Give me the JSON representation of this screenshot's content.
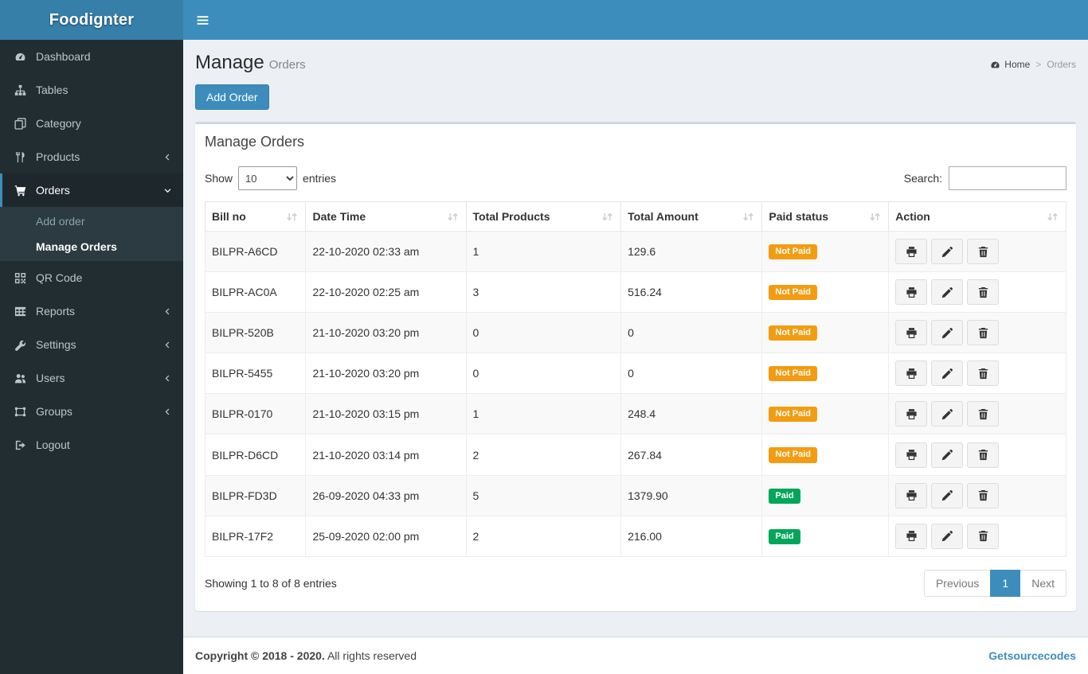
{
  "brand": "Foodignter",
  "colors": {
    "accent": "#3c8dbc",
    "logo_bg": "#367fa9",
    "sidebar_bg": "#222d32",
    "submenu_bg": "#2c3b41",
    "content_bg": "#ecf0f5",
    "not_paid_badge": "#f39c12",
    "paid_badge": "#00a65a"
  },
  "sidebar": {
    "items": [
      {
        "label": "Dashboard",
        "icon": "dashboard"
      },
      {
        "label": "Tables",
        "icon": "sitemap"
      },
      {
        "label": "Category",
        "icon": "copy"
      },
      {
        "label": "Products",
        "icon": "cutlery",
        "chevron": "left"
      },
      {
        "label": "Orders",
        "icon": "cart",
        "chevron": "down",
        "active": true,
        "submenu": [
          {
            "label": "Add order"
          },
          {
            "label": "Manage Orders",
            "active": true
          }
        ]
      },
      {
        "label": "QR Code",
        "icon": "qrcode"
      },
      {
        "label": "Reports",
        "icon": "table",
        "chevron": "left"
      },
      {
        "label": "Settings",
        "icon": "wrench",
        "chevron": "left"
      },
      {
        "label": "Users",
        "icon": "users",
        "chevron": "left"
      },
      {
        "label": "Groups",
        "icon": "group",
        "chevron": "left"
      },
      {
        "label": "Logout",
        "icon": "logout"
      }
    ]
  },
  "content_header": {
    "title": "Manage",
    "subtitle": "Orders",
    "breadcrumb": {
      "home": "Home",
      "separator": ">",
      "current": "Orders"
    }
  },
  "add_order_button": "Add Order",
  "box": {
    "title": "Manage Orders",
    "length_menu": {
      "prefix": "Show",
      "selected": "10",
      "suffix": "entries"
    },
    "search_label": "Search:",
    "table": {
      "columns": [
        "Bill no",
        "Date Time",
        "Total Products",
        "Total Amount",
        "Paid status",
        "Action"
      ],
      "rows": [
        {
          "bill_no": "BILPR-A6CD",
          "date_time": "22-10-2020 02:33 am",
          "total_products": "1",
          "total_amount": "129.6",
          "paid_status": "Not Paid"
        },
        {
          "bill_no": "BILPR-AC0A",
          "date_time": "22-10-2020 02:25 am",
          "total_products": "3",
          "total_amount": "516.24",
          "paid_status": "Not Paid"
        },
        {
          "bill_no": "BILPR-520B",
          "date_time": "21-10-2020 03:20 pm",
          "total_products": "0",
          "total_amount": "0",
          "paid_status": "Not Paid"
        },
        {
          "bill_no": "BILPR-5455",
          "date_time": "21-10-2020 03:20 pm",
          "total_products": "0",
          "total_amount": "0",
          "paid_status": "Not Paid"
        },
        {
          "bill_no": "BILPR-0170",
          "date_time": "21-10-2020 03:15 pm",
          "total_products": "1",
          "total_amount": "248.4",
          "paid_status": "Not Paid"
        },
        {
          "bill_no": "BILPR-D6CD",
          "date_time": "21-10-2020 03:14 pm",
          "total_products": "2",
          "total_amount": "267.84",
          "paid_status": "Not Paid"
        },
        {
          "bill_no": "BILPR-FD3D",
          "date_time": "26-09-2020 04:33 pm",
          "total_products": "5",
          "total_amount": "1379.90",
          "paid_status": "Paid"
        },
        {
          "bill_no": "BILPR-17F2",
          "date_time": "25-09-2020 02:00 pm",
          "total_products": "2",
          "total_amount": "216.00",
          "paid_status": "Paid"
        }
      ]
    },
    "info": "Showing 1 to 8 of 8 entries",
    "pagination": {
      "previous": "Previous",
      "page": "1",
      "next": "Next"
    }
  },
  "footer": {
    "copyright_bold": "Copyright © 2018 - 2020.",
    "copyright_text": "All rights reserved",
    "credit": "Getsourcecodes"
  }
}
